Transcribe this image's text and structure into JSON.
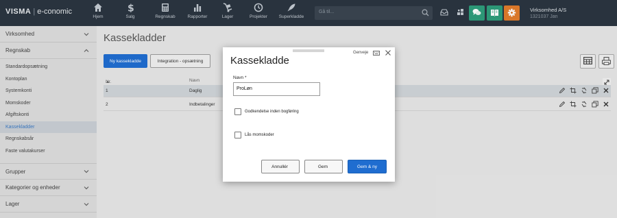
{
  "topbar": {
    "brand": "VISMA",
    "product": "e-conomic",
    "nav": [
      {
        "label": "Hjem",
        "icon": "home-icon"
      },
      {
        "label": "Salg",
        "icon": "dollar-icon"
      },
      {
        "label": "Regnskab",
        "icon": "calculator-icon"
      },
      {
        "label": "Rapporter",
        "icon": "bar-chart-icon"
      },
      {
        "label": "Lager",
        "icon": "dolly-icon"
      },
      {
        "label": "Projekter",
        "icon": "clock-icon"
      },
      {
        "label": "Superkladde",
        "icon": "rocket-icon"
      }
    ],
    "search_placeholder": "Gå til...",
    "company_name": "Virksomhed A/S",
    "company_sub": "1321037 Jan",
    "colors": {
      "bg": "#2b3540",
      "chat": "#2e9c7a",
      "help": "#2e9c7a",
      "settings": "#e17b2b"
    }
  },
  "sidebar": {
    "sections_top": [
      {
        "label": "Virksomhed",
        "expanded": false
      },
      {
        "label": "Regnskab",
        "expanded": true
      }
    ],
    "regnskab_items": [
      {
        "label": "Standardopsætning",
        "active": false
      },
      {
        "label": "Kontoplan",
        "active": false
      },
      {
        "label": "Systemkonti",
        "active": false
      },
      {
        "label": "Momskoder",
        "active": false
      },
      {
        "label": "Afgiftskonti",
        "active": false
      },
      {
        "label": "Kassekladder",
        "active": true
      },
      {
        "label": "Regnskabsår",
        "active": false
      },
      {
        "label": "Faste valutakurser",
        "active": false
      }
    ],
    "sections_bottom": [
      {
        "label": "Grupper"
      },
      {
        "label": "Kategorier og enheder"
      },
      {
        "label": "Lager"
      }
    ]
  },
  "main": {
    "title": "Kassekladder",
    "new_button": "Ny kassekladde",
    "integration_button": "Integration - opsætning",
    "table": {
      "col_nr": "Nr.",
      "col_navn": "Navn",
      "rows": [
        {
          "nr": "1",
          "navn": "Daglig"
        },
        {
          "nr": "2",
          "navn": "Indbetalinger"
        }
      ]
    }
  },
  "dialog": {
    "title": "Kassekladde",
    "shortcut_label": "Genveje",
    "name_label": "Navn *",
    "name_value": "ProLøn",
    "checkbox_approve": {
      "label": "Godkendelse inden bogføring",
      "checked": false
    },
    "checkbox_lock": {
      "label": "Lås momskoder",
      "checked": false
    },
    "cancel_button": "Annullér",
    "save_button": "Gem",
    "save_new_button": "Gem & ny"
  }
}
